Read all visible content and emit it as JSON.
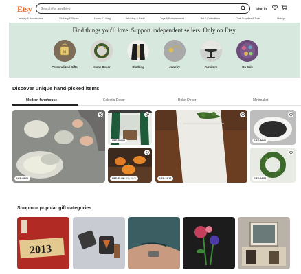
{
  "header": {
    "logo": "Etsy",
    "search_placeholder": "Search for anything",
    "sign_in": "Sign in",
    "icons": [
      "search-icon",
      "heart-icon",
      "cart-icon"
    ]
  },
  "categories": [
    "Jewelry & Accessories",
    "Clothing & Shoes",
    "Home & Living",
    "Wedding & Party",
    "Toys & Entertainment",
    "Art & Collectibles",
    "Craft Supplies & Tools",
    "Vintage"
  ],
  "banner": {
    "tagline": "Find things you'll love. Support independent sellers. Only on Etsy.",
    "circles": [
      {
        "label": "Personalized Gifts"
      },
      {
        "label": "Home Decor"
      },
      {
        "label": "Clothing"
      },
      {
        "label": "Jewelry"
      },
      {
        "label": "Furniture"
      },
      {
        "label": "On Sale"
      }
    ]
  },
  "discover": {
    "title": "Discover unique hand-picked items",
    "tabs": [
      {
        "label": "Modern farmhouse",
        "active": true
      },
      {
        "label": "Eclectic Decor",
        "active": false
      },
      {
        "label": "Boho Decor",
        "active": false
      },
      {
        "label": "Minimalist",
        "active": false
      }
    ],
    "items": [
      {
        "price": "USD 65.00"
      },
      {
        "price": "USD 200.00"
      },
      {
        "price": "USD 35.99",
        "original_price": "USD 45.00"
      },
      {
        "price": "USD 24.17"
      },
      {
        "price": "USD 36.00"
      },
      {
        "price": "USD 24.00"
      }
    ]
  },
  "gifts": {
    "title": "Shop our popular gift categories",
    "items": [
      {
        "image_text": "2013"
      },
      {},
      {},
      {},
      {}
    ]
  },
  "colors": {
    "brand": "#f1641e",
    "banner_bg": "#d7e9df"
  }
}
